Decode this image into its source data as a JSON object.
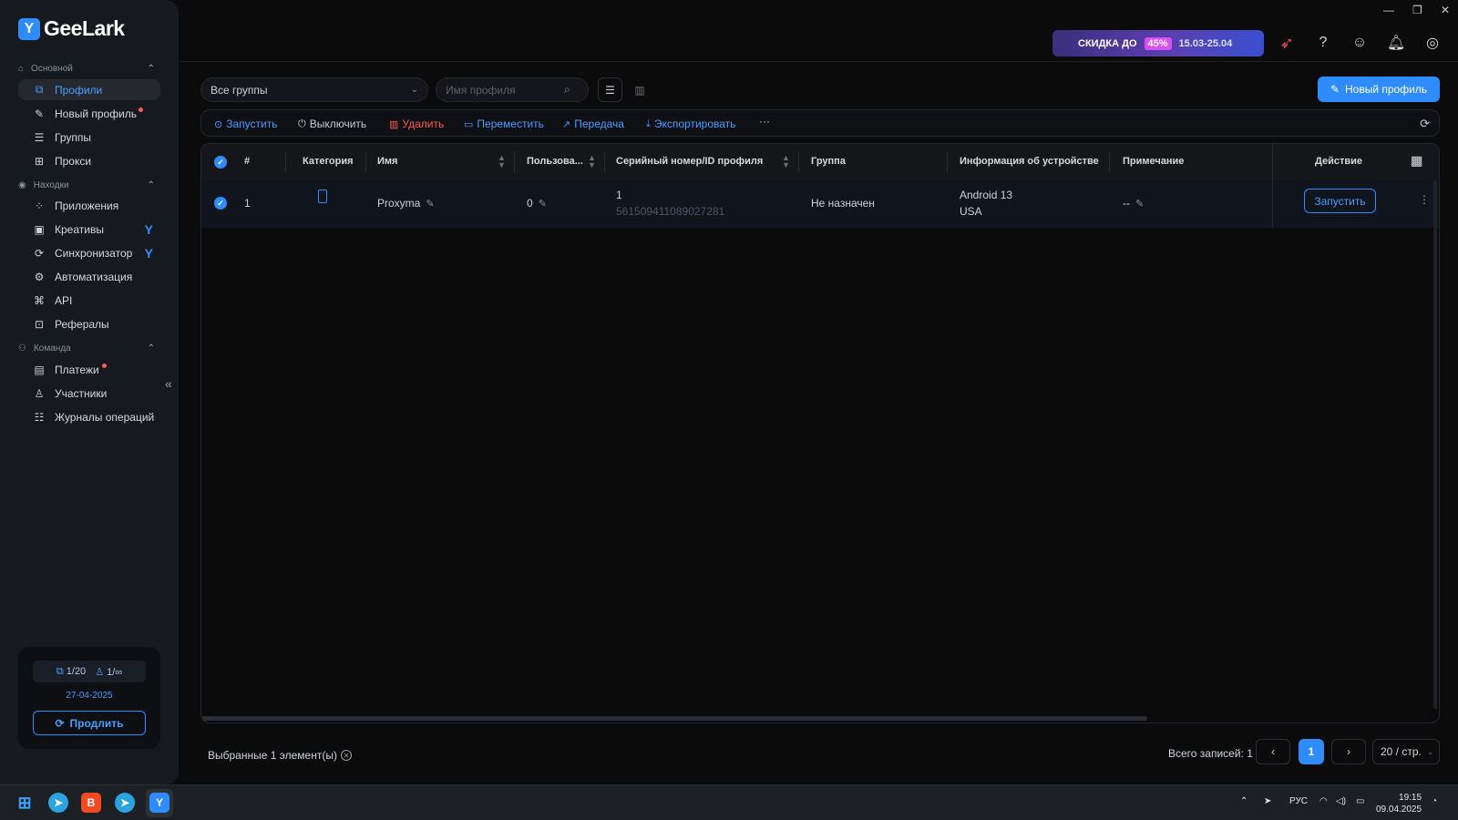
{
  "app": {
    "name": "GeeLark"
  },
  "sidebar": {
    "sections": [
      {
        "label": "Основной",
        "items": [
          {
            "label": "Профили",
            "icon": "profiles-icon",
            "active": true
          },
          {
            "label": "Новый профиль",
            "icon": "edit-icon",
            "dot": true
          },
          {
            "label": "Группы",
            "icon": "list-icon"
          },
          {
            "label": "Прокси",
            "icon": "proxy-icon"
          }
        ]
      },
      {
        "label": "Находки",
        "items": [
          {
            "label": "Приложения",
            "icon": "apps-icon"
          },
          {
            "label": "Креативы",
            "icon": "creatives-icon",
            "badge": "bird"
          },
          {
            "label": "Синхронизатор",
            "icon": "sync-icon",
            "badge": "bird"
          },
          {
            "label": "Автоматизация",
            "icon": "robot-icon"
          },
          {
            "label": "API",
            "icon": "api-icon"
          },
          {
            "label": "Рефералы",
            "icon": "gift-icon"
          }
        ]
      },
      {
        "label": "Команда",
        "items": [
          {
            "label": "Платежи",
            "icon": "payments-icon",
            "dot": true
          },
          {
            "label": "Участники",
            "icon": "user-icon"
          },
          {
            "label": "Журналы операций",
            "icon": "logs-icon"
          }
        ]
      }
    ],
    "plan": {
      "profiles": "1/20",
      "members": "1/∞",
      "date": "27-04-2025",
      "renew_label": "Продлить"
    }
  },
  "topbar": {
    "promo": {
      "text": "СКИДКА ДО",
      "percent": "45%",
      "dates": "15.03-25.04"
    }
  },
  "filters": {
    "group_select": "Все группы",
    "search_placeholder": "Имя профиля",
    "new_profile_label": "Новый профиль"
  },
  "actions": [
    {
      "label": "Запустить",
      "style": "primary",
      "icon": "play-icon"
    },
    {
      "label": "Выключить",
      "style": "normal",
      "icon": "power-icon"
    },
    {
      "label": "Удалить",
      "style": "danger",
      "icon": "trash-icon"
    },
    {
      "label": "Переместить",
      "style": "primary",
      "icon": "move-icon"
    },
    {
      "label": "Передача",
      "style": "primary",
      "icon": "share-icon"
    },
    {
      "label": "Экспортировать",
      "style": "primary",
      "icon": "export-icon"
    }
  ],
  "table": {
    "columns": [
      "#",
      "Категория",
      "Имя",
      "Пользова...",
      "Серийный номер/ID профиля",
      "Группа",
      "Информация об устройстве",
      "Примечание",
      "Действие"
    ],
    "rows": [
      {
        "index": "1",
        "category": "phone-icon",
        "name": "Proxyma",
        "users": "0",
        "serial": "1",
        "profile_id": "561509411089027281",
        "group": "Не назначен",
        "device_os": "Android 13",
        "device_region": "USA",
        "note": "--",
        "action_label": "Запустить"
      }
    ]
  },
  "footer": {
    "selected": "Выбранные 1 элемент(ы)",
    "total": "Всего записей: 1",
    "current_page": "1",
    "per_page": "20 / стр."
  },
  "taskbar": {
    "lang": "РУС",
    "time": "19:15",
    "date": "09.04.2025"
  },
  "colors": {
    "accent": "#2f8cff",
    "danger": "#ff5a5a",
    "background": "#0b0b0c",
    "sidebar": "#16191e"
  }
}
